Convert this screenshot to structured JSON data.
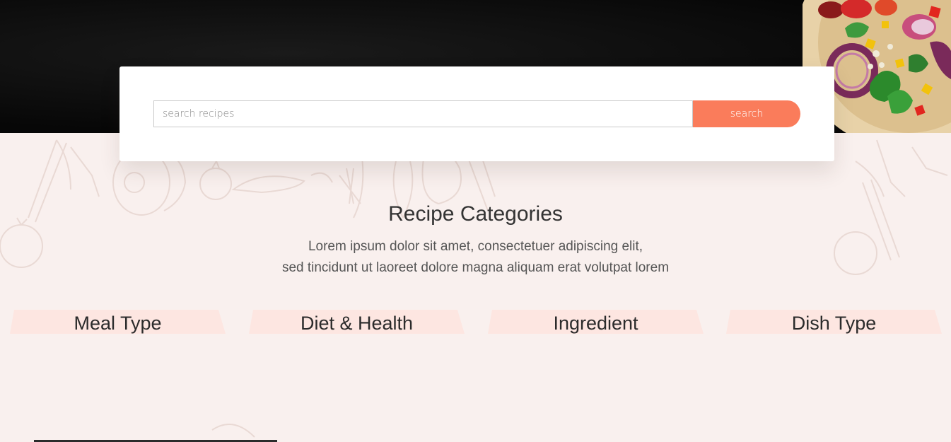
{
  "search": {
    "placeholder": "search recipes",
    "button_label": "search"
  },
  "section": {
    "title": "Recipe Categories",
    "desc_line1": "Lorem ipsum dolor sit amet, consectetuer adipiscing elit,",
    "desc_line2": "sed tincidunt ut laoreet dolore magna aliquam erat volutpat lorem"
  },
  "categories": [
    {
      "label": "Meal Type"
    },
    {
      "label": "Diet & Health"
    },
    {
      "label": "Ingredient"
    },
    {
      "label": "Dish Type"
    }
  ],
  "colors": {
    "accent": "#fa7c5b",
    "page_bg": "#f9f0ee",
    "tab_bg": "#fde6e1",
    "hero_bg": "#080808"
  },
  "icons": [
    "food-hero-image",
    "kitchen-doodle-pattern"
  ]
}
